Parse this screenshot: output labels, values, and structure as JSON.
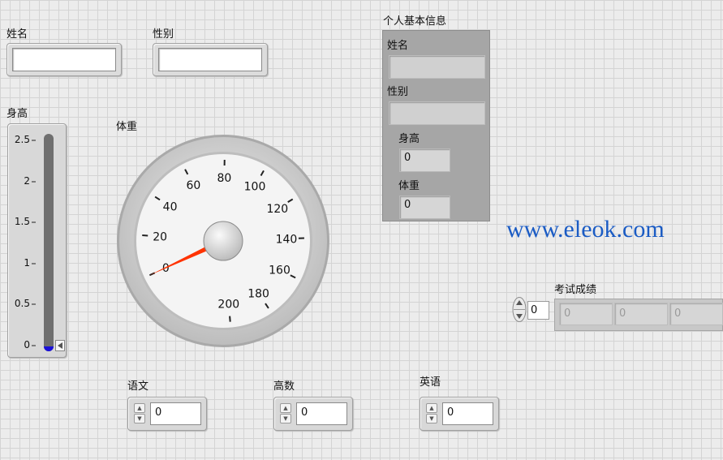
{
  "name_control": {
    "label": "姓名",
    "value": ""
  },
  "gender_control": {
    "label": "性别",
    "value": ""
  },
  "height_tank": {
    "label": "身高",
    "value": 0,
    "scale": [
      "2.5",
      "2",
      "1.5",
      "1",
      "0.5",
      "0"
    ]
  },
  "weight_gauge": {
    "label": "体重",
    "value": 0,
    "scale": [
      "0",
      "20",
      "40",
      "60",
      "80",
      "100",
      "120",
      "140",
      "160",
      "180",
      "200"
    ]
  },
  "info_cluster": {
    "title": "个人基本信息",
    "name_label": "姓名",
    "name_value": "",
    "gender_label": "性别",
    "gender_value": "",
    "height_label": "身高",
    "height_value": "0",
    "weight_label": "体重",
    "weight_value": "0"
  },
  "watermark": "www.eleok.com",
  "scores_array": {
    "label": "考试成绩",
    "index": "0",
    "elements": [
      "0",
      "0",
      "0"
    ]
  },
  "chinese": {
    "label": "语文",
    "value": "0"
  },
  "math": {
    "label": "高数",
    "value": "0"
  },
  "english": {
    "label": "英语",
    "value": "0"
  },
  "colors": {
    "tank_fill": "#1a10d8",
    "needle": "#ff3300",
    "watermark": "#1a5bc4"
  },
  "icons": {
    "spin_up": "increment-arrow-icon",
    "spin_down": "decrement-arrow-icon",
    "tank_pointer": "slider-pointer-icon"
  }
}
